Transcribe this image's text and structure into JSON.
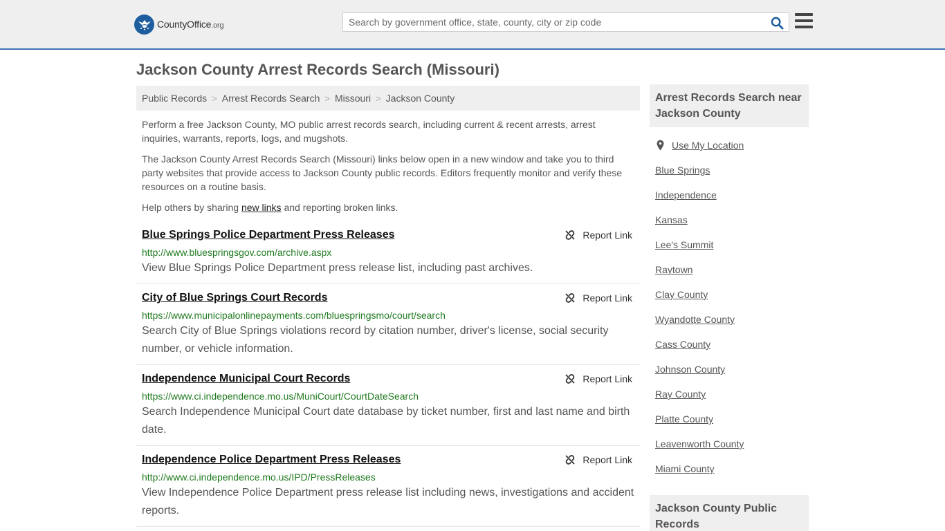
{
  "header": {
    "logo_main": "CountyOffice",
    "logo_tld": ".org",
    "search_placeholder": "Search by government office, state, county, city or zip code"
  },
  "page_title": "Jackson County Arrest Records Search (Missouri)",
  "breadcrumb": [
    "Public Records",
    "Arrest Records Search",
    "Missouri",
    "Jackson County"
  ],
  "intro": {
    "p1": "Perform a free Jackson County, MO public arrest records search, including current & recent arrests, arrest inquiries, warrants, reports, logs, and mugshots.",
    "p2": "The Jackson County Arrest Records Search (Missouri) links below open in a new window and take you to third party websites that provide access to Jackson County public records. Editors frequently monitor and verify these resources on a routine basis.",
    "p3_before": "Help others by sharing ",
    "p3_link": "new links",
    "p3_after": " and reporting broken links."
  },
  "report_label": "Report Link",
  "results": [
    {
      "title": "Blue Springs Police Department Press Releases",
      "url": "http://www.bluespringsgov.com/archive.aspx",
      "desc": "View Blue Springs Police Department press release list, including past archives."
    },
    {
      "title": "City of Blue Springs Court Records",
      "url": "https://www.municipalonlinepayments.com/bluespringsmo/court/search",
      "desc": "Search City of Blue Springs violations record by citation number, driver's license, social security number, or vehicle information."
    },
    {
      "title": "Independence Municipal Court Records",
      "url": "https://www.ci.independence.mo.us/MuniCourt/CourtDateSearch",
      "desc": "Search Independence Municipal Court date database by ticket number, first and last name and birth date."
    },
    {
      "title": "Independence Police Department Press Releases",
      "url": "http://www.ci.independence.mo.us/IPD/PressReleases",
      "desc": "View Independence Police Department press release list including news, investigations and accident reports."
    }
  ],
  "sidebar": {
    "nearby_heading": "Arrest Records Search near Jackson County",
    "use_location": "Use My Location",
    "nearby": [
      "Blue Springs",
      "Independence",
      "Kansas",
      "Lee's Summit",
      "Raytown",
      "Clay County",
      "Wyandotte County",
      "Cass County",
      "Johnson County",
      "Ray County",
      "Platte County",
      "Leavenworth County",
      "Miami County"
    ],
    "public_records_heading": "Jackson County Public Records"
  }
}
